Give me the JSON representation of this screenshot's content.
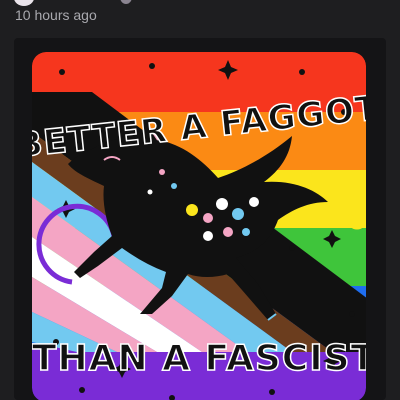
{
  "post": {
    "timestamp": "10 hours ago"
  },
  "artwork": {
    "top_text": "BETTER A FAGGOT",
    "bottom_text": "THAN A FASCIST",
    "icon": "pride-dog-illustration",
    "colors": {
      "red": "#f6361e",
      "orange": "#fb8a14",
      "yellow": "#fbe51c",
      "green": "#3fc53b",
      "blue": "#1f6ef0",
      "purple": "#7a2cd6",
      "light_blue": "#72c9f0",
      "pink": "#f4a5c4",
      "white": "#ffffff",
      "brown": "#6b3d1e",
      "black": "#111111"
    }
  }
}
